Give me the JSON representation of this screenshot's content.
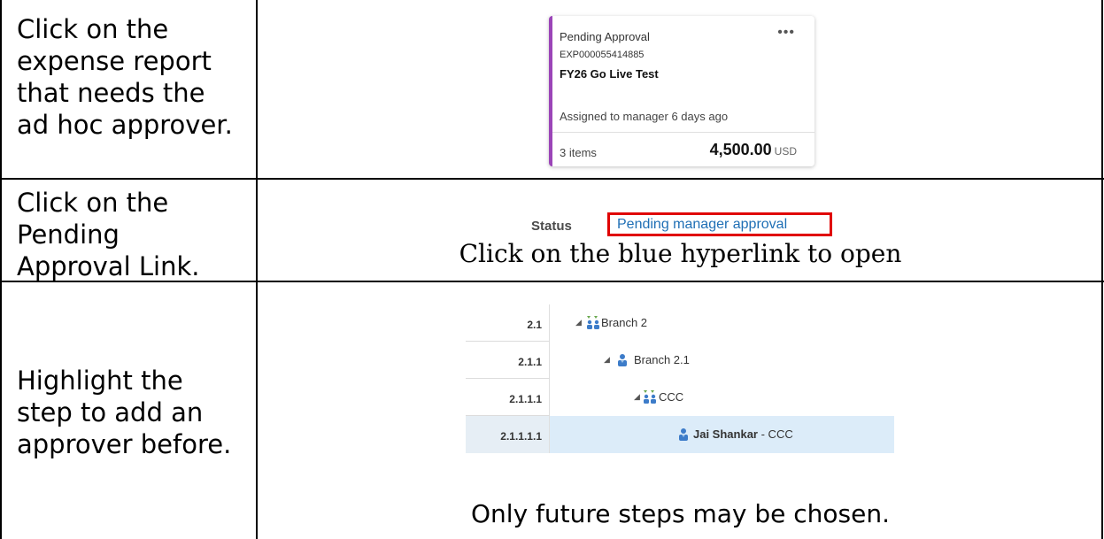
{
  "rows": [
    {
      "instruction": "Click on the expense report that needs the ad hoc approver."
    },
    {
      "instruction": "Click on the Pending Approval Link."
    },
    {
      "instruction": "Highlight the step to add an approver before."
    }
  ],
  "card": {
    "status": "Pending Approval",
    "menu_glyph": "•••",
    "report_number": "EXP000055414885",
    "title": "FY26 Go Live Test",
    "assigned": "Assigned to manager 6 days ago",
    "items": "3 items",
    "amount": "4,500.00",
    "currency": "USD",
    "accent_color": "#9b45b8"
  },
  "status_row": {
    "label": "Status",
    "link": "Pending manager approval",
    "caption": "Click on the blue hyperlink to open",
    "link_color": "#1f6fb5",
    "highlight_color": "#e00000"
  },
  "tree": {
    "rows": [
      {
        "num": "2.1",
        "caret": "◢",
        "icon": "group-icon",
        "label": "Branch 2",
        "suffix": ""
      },
      {
        "num": "2.1.1",
        "caret": "◢",
        "icon": "user-icon",
        "label": "Branch 2.1",
        "suffix": ""
      },
      {
        "num": "2.1.1.1",
        "caret": "◢",
        "icon": "group-icon",
        "label": "CCC",
        "suffix": ""
      },
      {
        "num": "2.1.1.1.1",
        "caret": "",
        "icon": "user-icon",
        "label": "Jai Shankar",
        "suffix": " - CCC"
      }
    ],
    "selected_color": "#dcecf9",
    "caption": "Only future steps may be chosen."
  }
}
